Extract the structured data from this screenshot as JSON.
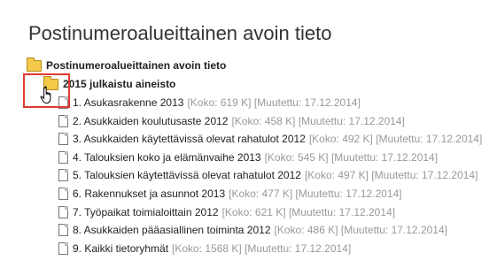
{
  "page": {
    "title": "Postinumeroalueittainen avoin tieto"
  },
  "tree": {
    "root": {
      "label": "Postinumeroalueittainen avoin tieto",
      "icon": "folder-icon"
    },
    "subfolder": {
      "label": "2015 julkaistu aineisto",
      "icon": "folder-open-icon"
    },
    "files": [
      {
        "label": "1. Asukasrakenne 2013",
        "meta": "[Koko: 619 K] [Muutettu: 17.12.2014]"
      },
      {
        "label": "2. Asukkaiden koulutusaste 2012",
        "meta": "[Koko: 458 K] [Muutettu: 17.12.2014]"
      },
      {
        "label": "3. Asukkaiden käytettävissä olevat rahatulot 2012",
        "meta": "[Koko: 492 K] [Muutettu: 17.12.2014]"
      },
      {
        "label": "4. Talouksien koko ja elämänvaihe 2013",
        "meta": "[Koko: 545 K] [Muutettu: 17.12.2014]"
      },
      {
        "label": "5. Talouksien käytettävissä olevat rahatulot 2012",
        "meta": "[Koko: 497 K] [Muutettu: 17.12.2014]"
      },
      {
        "label": "6. Rakennukset ja asunnot 2013",
        "meta": "[Koko: 477 K] [Muutettu: 17.12.2014]"
      },
      {
        "label": "7. Työpaikat toimialoittain 2012",
        "meta": "[Koko: 621 K] [Muutettu: 17.12.2014]"
      },
      {
        "label": "8. Asukkaiden pääasiallinen toiminta 2012",
        "meta": "[Koko: 486 K] [Muutettu: 17.12.2014]"
      },
      {
        "label": "9. Kaikki tietoryhmät",
        "meta": "[Koko: 1568 K] [Muutettu: 17.12.2014]"
      }
    ]
  },
  "colors": {
    "highlight": "#e03a2f",
    "folder": "#f4c94a",
    "meta_text": "#999999"
  },
  "cursor": {
    "icon": "hand-pointer-icon"
  }
}
